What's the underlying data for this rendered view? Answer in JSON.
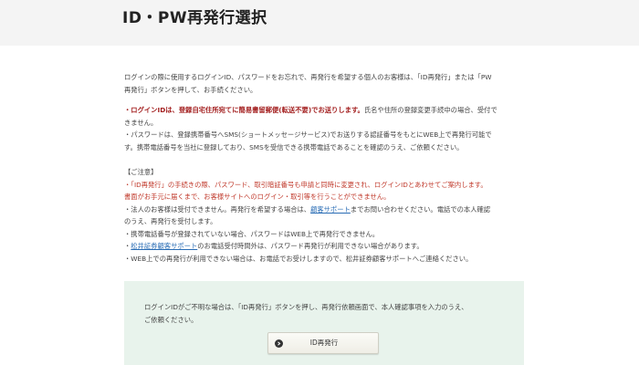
{
  "header": {
    "title": "ID・PW再発行選択"
  },
  "intro": {
    "line1": "ログインの際に使用するログインID、パスワードをお忘れで、再発行を希望する個人のお客様は、「ID再発行」または「PW",
    "line2": "再発行」ボタンを押して、お手続ください。"
  },
  "login_info": {
    "bullet1_bold": "・ログインIDは、登録自宅住所宛てに簡易書留郵便(転送不要)でお送りします。",
    "bullet1_rest": "氏名や住所の登録変更手続中の場合、受付で",
    "bullet1_line2": "きません。",
    "bullet2_line1": "・パスワードは、登録携帯番号へSMS(ショートメッセージサービス)でお送りする認証番号をもとにWEB上で再発行可能で",
    "bullet2_line2": "す。携帯電話番号を当社に登録しており、SMSを受信できる携帯電話であることを確認のうえ、ご依頼ください。"
  },
  "notes": {
    "heading": "【ご注意】",
    "red_line1": "・「ID再発行」の手続きの際、パスワード、取引暗証番号も申請と同時に変更され、ログインIDとあわせてご案内します。",
    "red_line2": "書面がお手元に届くまで、お客様サイトへのログイン・取引等を行うことができません。",
    "corp_before": "・法人のお客様は受付できません。再発行を希望する場合は、",
    "corp_link": "顧客サポート",
    "corp_after": "までお問い合わせください。電話での本人確認",
    "corp_line2": "のうえ、再発行を受付します。",
    "mobile_line": "・携帯電話番号が登録されていない場合、パスワードはWEB上で再発行できません。",
    "support_before": "・",
    "support_link": "松井証券顧客サポート",
    "support_after": "のお電話受付時間外は、パスワード再発行が利用できない場合があります。",
    "web_line": "・WEB上での再発行が利用できない場合は、お電話でお受けしますので、松井証券顧客サポートへご連絡ください。"
  },
  "id_box": {
    "line1": "ログインIDがご不明な場合は、「ID再発行」ボタンを押し、再発行依頼画面で、本人確認事項を入力のうえ、",
    "line2": "ご依頼ください。",
    "button_label": "ID再発行"
  },
  "colors": {
    "header_bg": "#f4f4f4",
    "warning_red": "#c0392b",
    "link_blue": "#2a6db5",
    "box_green": "#e8f3ec"
  },
  "icons": {
    "button_icon": "arrow-circle-icon"
  }
}
